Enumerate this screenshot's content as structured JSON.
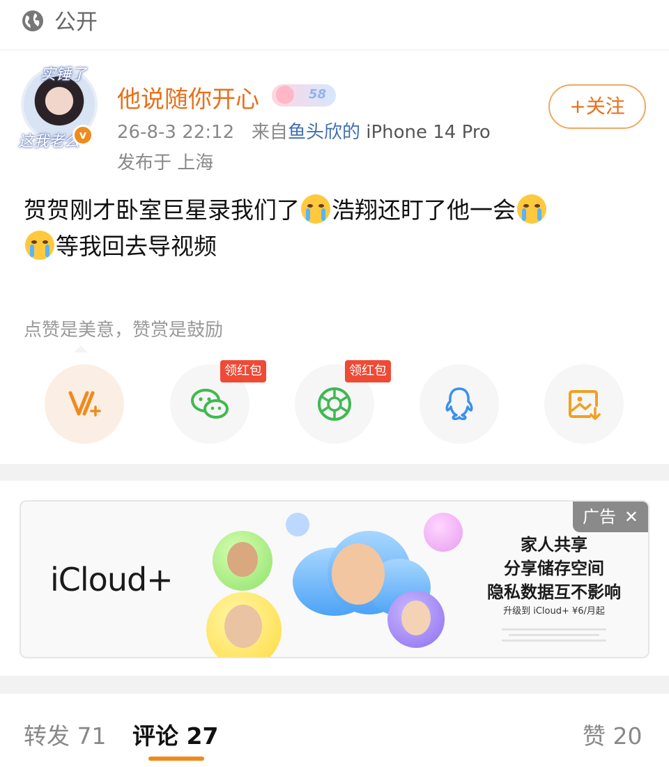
{
  "topbar": {
    "visibility_label": "公开",
    "icon": "globe-icon"
  },
  "post": {
    "author": {
      "name": "他说随你开心",
      "level_badge": "58",
      "avatar_text_top": "实锤了",
      "avatar_text_bottom": "这我老么",
      "verified_mark": "v"
    },
    "follow_label": "+关注",
    "timestamp": "26-8-3 22:12",
    "source_prefix": "来自",
    "source_name": "鱼头欣的",
    "device": "iPhone 14 Pro",
    "location": "发布于 上海",
    "content": {
      "part1": "贺贺刚才卧室巨星录我们了",
      "part2": "浩翔还盯了他一会",
      "part3": "等我回去导视频",
      "emoji": "crying-emoji"
    },
    "reward_hint": "点赞是美意，赞赏是鼓励",
    "share_buttons": [
      {
        "name": "vplus",
        "icon": "vplus-icon",
        "color": "#f08a1c"
      },
      {
        "name": "wechat",
        "icon": "wechat-icon",
        "color": "#3fb950",
        "badge": "领红包"
      },
      {
        "name": "moments",
        "icon": "moments-icon",
        "color": "#3fb950",
        "badge": "领红包"
      },
      {
        "name": "qq",
        "icon": "qq-icon",
        "color": "#3a8ff0"
      },
      {
        "name": "save-image",
        "icon": "save-image-icon",
        "color": "#f0a020"
      }
    ]
  },
  "ad": {
    "tag": "广告",
    "close": "✕",
    "brand": "iCloud+",
    "line1": "家人共享",
    "line2": "分享储存空间",
    "line3": "隐私数据互不影响",
    "sub": "升级到 iCloud+ ¥6/月起"
  },
  "tabs": {
    "repost": {
      "label": "转发",
      "count": "71"
    },
    "comment": {
      "label": "评论",
      "count": "27"
    },
    "like": {
      "label": "赞",
      "count": "20"
    }
  },
  "colors": {
    "accent": "#f08a1c",
    "username": "#e8701a",
    "link": "#3f6fb1",
    "redpacket": "#ee4a36"
  }
}
